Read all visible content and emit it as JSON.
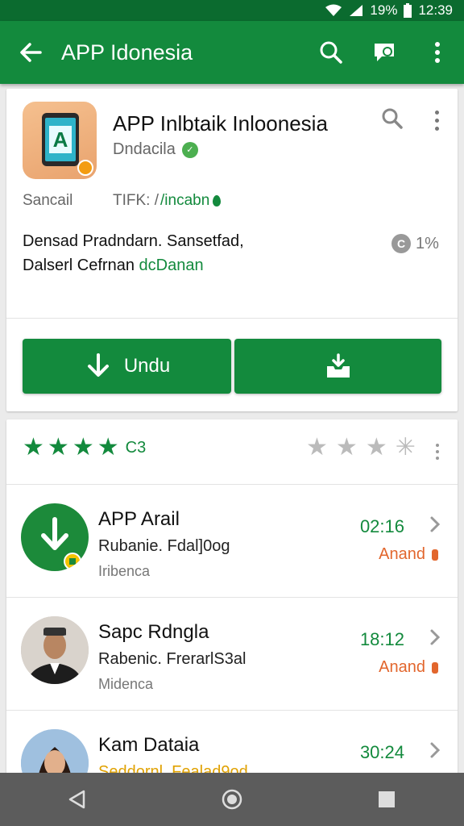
{
  "status_bar": {
    "battery": "19%",
    "time": "12:39"
  },
  "app_bar": {
    "title": "APP Idonesia"
  },
  "app_card": {
    "title": "APP Inlbtaik Inloonesia",
    "developer": "Dndacila",
    "category": "Sancail",
    "tag_prefix": "TIFK: /",
    "tag_link": "/incabn",
    "description_line1": "Densad Pradndarn. Sansetfad,",
    "description_line2_prefix": "Dalserl Cefrnan ",
    "description_line2_green": "dcDanan",
    "size": "1%",
    "install_label": "Undu"
  },
  "rating": {
    "count": "C3",
    "filled_stars": 4
  },
  "list_items": [
    {
      "name": "APP Arail",
      "subtitle": "Rubanie. Fdal]0og",
      "meta": "Iribenca",
      "time": "02:16",
      "status": "Anand"
    },
    {
      "name": "Sapc Rdngla",
      "subtitle": "Rabenic. FrerarlS3al",
      "meta": "Midenca",
      "time": "18:12",
      "status": "Anand"
    },
    {
      "name": "Kam Dataia",
      "subtitle": "Seddornl. Fealad9od",
      "meta": "",
      "time": "30:24",
      "status": ""
    }
  ],
  "colors": {
    "primary": "#138a3d",
    "status_bar": "#0b6b2f",
    "accent_orange": "#e2662d",
    "nav_bar": "#5c5c5c"
  },
  "icons": {
    "app_bar": [
      "back-arrow-icon",
      "search-icon",
      "feedback-icon",
      "more-vert-icon"
    ],
    "nav": [
      "back-triangle-icon",
      "home-circle-icon",
      "recents-square-icon"
    ]
  }
}
